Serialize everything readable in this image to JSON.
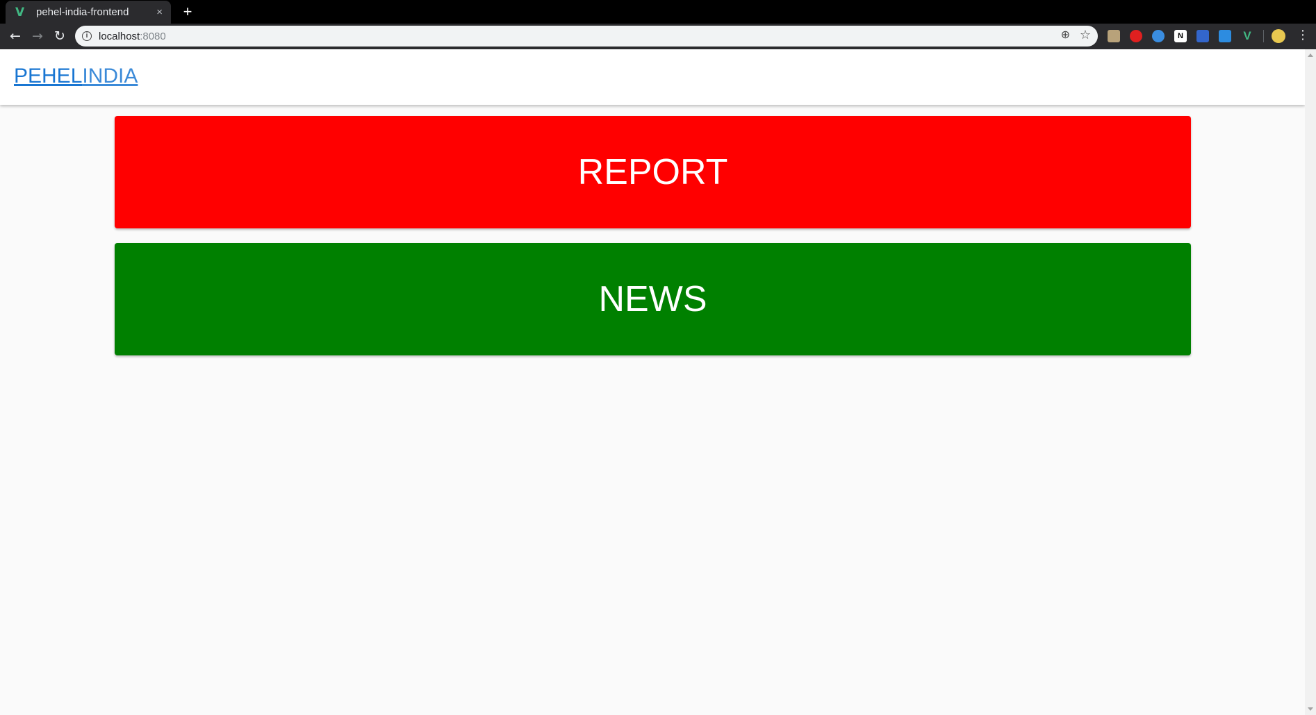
{
  "browser": {
    "tab_title": "pehel-india-frontend",
    "tab_favicon": "V",
    "new_tab": "+",
    "close": "×",
    "url_host": "localhost",
    "url_port": ":8080",
    "icons": [
      "back-arrow-icon",
      "forward-arrow-icon",
      "reload-icon",
      "info-icon",
      "zoom-icon",
      "star-icon",
      "menu-icon"
    ]
  },
  "app": {
    "brand_bold": "PEHEL",
    "brand_light": "INDIA"
  },
  "cards": {
    "report": {
      "label": "REPORT",
      "color": "#ff0000"
    },
    "news": {
      "label": "NEWS",
      "color": "#008000"
    }
  },
  "colors": {
    "brand": "#1976d2",
    "background": "#fafafa"
  }
}
